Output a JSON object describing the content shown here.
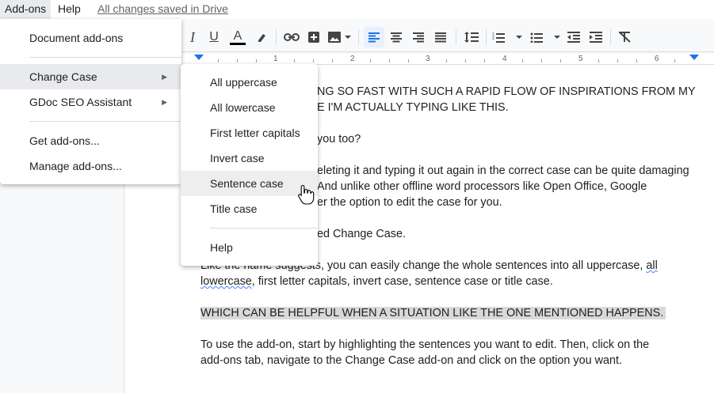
{
  "menubar": {
    "addons": "Add-ons",
    "help": "Help",
    "saved": "All changes saved in Drive"
  },
  "toolbar": {
    "icons": [
      "italic-icon",
      "underline-icon",
      "text-color-icon",
      "highlight-icon",
      "link-icon",
      "insert-comment-icon",
      "insert-image-icon",
      "align-left-icon",
      "align-center-icon",
      "align-right-icon",
      "justify-icon",
      "line-spacing-icon",
      "numbered-list-icon",
      "bulleted-list-icon",
      "decrease-indent-icon",
      "increase-indent-icon",
      "clear-formatting-icon"
    ],
    "italic": "I",
    "underline": "U",
    "text_color": "A"
  },
  "ruler": {
    "labels": [
      "1",
      "2",
      "3",
      "4",
      "5",
      "6"
    ]
  },
  "addons_menu": {
    "items": [
      {
        "label": "Document add-ons"
      },
      {
        "label": "Change Case",
        "arrow": "▶"
      },
      {
        "label": "GDoc SEO Assistant",
        "arrow": "▶"
      },
      {
        "label": "Get add-ons..."
      },
      {
        "label": "Manage add-ons..."
      }
    ]
  },
  "change_case_menu": {
    "items": [
      {
        "label": "All uppercase"
      },
      {
        "label": "All lowercase"
      },
      {
        "label": "First letter capitals"
      },
      {
        "label": "Invert case"
      },
      {
        "label": "Sentence case",
        "hovered": true
      },
      {
        "label": "Title case"
      },
      {
        "label": "Help"
      }
    ]
  },
  "document": {
    "p1_line1": "NG SO FAST WITH SUCH A RAPID FLOW OF INSPIRATIONS FROM MY",
    "p1_line2": "E I'M ACTUALLY TYPING LIKE THIS.",
    "p2": "you too?",
    "p3_line1": "eleting it and typing it out again in the correct case can be quite damaging",
    "p3_line2": "And unlike other offline word processors like Open Office, Google",
    "p3_line3": "er the option to edit the case for you.",
    "p4": "ed Change Case.",
    "p5_line1": "Like the name suggests, you can easily change the whole sentences into all uppercase,",
    "p5_all": "all",
    "p5_lower": "lowercase",
    "p5_line2_rest": ", first letter capitals, invert case, sentence case or title case.",
    "p6": "WHICH CAN BE HELPFUL WHEN A SITUATION LIKE THE ONE MENTIONED HAPPENS.",
    "p7_line1": "To use the add-on, start by highlighting the sentences you want to edit. Then, click on the",
    "p7_line2": "add-ons tab, navigate to the Change Case add-on and click on the option you want."
  },
  "colors": {
    "accent": "#1a73e8",
    "highlight": "#d9d9d9",
    "menu_hover": "#e8eaed"
  }
}
